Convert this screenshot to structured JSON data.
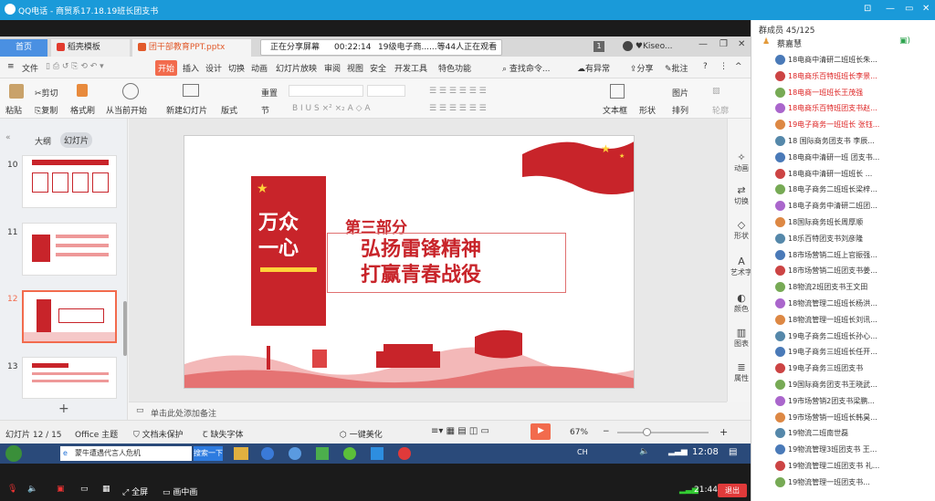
{
  "qq": {
    "title": "QQ电话 - 商贸系17.18.19班长团支书"
  },
  "tabs": {
    "home": "首页",
    "template": "稻壳模板",
    "doc": "团干部教育PPT.pptx",
    "user": "♥Kiseo..."
  },
  "share": {
    "status": "正在分享屏幕",
    "time": "00:22:14",
    "viewers": "19级电子商......等44人正在观看"
  },
  "menu": {
    "file": "文件",
    "items": [
      "开始",
      "插入",
      "设计",
      "切换",
      "动画",
      "幻灯片放映",
      "审阅",
      "视图",
      "安全",
      "开发工具",
      "特色功能"
    ],
    "search": "查找命令...",
    "problem": "有异常",
    "share": "分享",
    "comment": "批注"
  },
  "ribbon": {
    "paste": "粘贴",
    "cut": "剪切",
    "copy": "复制",
    "format": "格式刷",
    "from_current": "从当前开始",
    "new_slide": "新建幻灯片",
    "layout": "版式",
    "section": "节",
    "reset": "重置",
    "textbox": "文本框",
    "shape": "形状",
    "arrange": "排列",
    "picture": "图片",
    "outline": "轮廓"
  },
  "left": {
    "outline": "大纲",
    "slides": "幻灯片",
    "nums": [
      "10",
      "11",
      "12",
      "13"
    ],
    "add": "+"
  },
  "slide": {
    "left_title_1": "万众",
    "left_title_2": "一心",
    "part": "第三部分",
    "h1": "弘扬雷锋精神",
    "h2": "打赢青春战役"
  },
  "rightbar": [
    "动画",
    "切换",
    "形状",
    "艺术字",
    "颜色",
    "图表",
    "属性"
  ],
  "notes": {
    "placeholder": "单击此处添加备注"
  },
  "status": {
    "page": "幻灯片 12 / 15",
    "theme": "Office 主题",
    "protect": "文档未保护",
    "font": "缺失字体",
    "beautify": "一键美化",
    "zoom": "67%"
  },
  "taskbar": {
    "search": "蒙牛遭遇代言人危机",
    "search_btn": "搜索一下",
    "lang": "CH",
    "time": "12:08"
  },
  "bottom": {
    "fullscreen": "全屏",
    "pip": "画中画",
    "time": "21:44",
    "exit": "退出"
  },
  "panel": {
    "count": "群成员 45/125",
    "host": "蔡嘉慧",
    "members": [
      {
        "n": "18电商中清研二班班长朱...",
        "c": "#333"
      },
      {
        "n": "18电商乐百特班班长李景...",
        "c": "#d22"
      },
      {
        "n": "18电商一班班长王茂强",
        "c": "#d22"
      },
      {
        "n": "18电商乐百特班团支书赵...",
        "c": "#d22"
      },
      {
        "n": "19电子商务一班班长 张钰...",
        "c": "#d22"
      },
      {
        "n": "18  国际商务团支书 李辰...",
        "c": "#333"
      },
      {
        "n": "18电商中清研一班 团支书...",
        "c": "#333"
      },
      {
        "n": "18电商中清研一班班长 ...",
        "c": "#333"
      },
      {
        "n": "18电子商务二班班长梁梓...",
        "c": "#333"
      },
      {
        "n": "18电子商务中清研二班团...",
        "c": "#333"
      },
      {
        "n": "18国际商务班长周厚顺",
        "c": "#333"
      },
      {
        "n": "18乐百特团支书刘彦隆",
        "c": "#333"
      },
      {
        "n": "18市场营销二班上官振强...",
        "c": "#333"
      },
      {
        "n": "18市场营销二班团支书姜...",
        "c": "#333"
      },
      {
        "n": "18物流2班团支书王文田",
        "c": "#333"
      },
      {
        "n": "18物流管理二班班长杨洪...",
        "c": "#333"
      },
      {
        "n": "18物流管理一班班长刘讯...",
        "c": "#333"
      },
      {
        "n": "19电子商务二班班长孙心...",
        "c": "#333"
      },
      {
        "n": "19电子商务三班班长任开...",
        "c": "#333"
      },
      {
        "n": "19电子商务三班团支书",
        "c": "#333"
      },
      {
        "n": "19国际商务团支书王晓武...",
        "c": "#333"
      },
      {
        "n": "19市场营销2团支书梁鹏...",
        "c": "#333"
      },
      {
        "n": "19市场营销一班班长韩昊...",
        "c": "#333"
      },
      {
        "n": "19物流二班南世磊",
        "c": "#333"
      },
      {
        "n": "19物流管理3班团支书 王...",
        "c": "#333"
      },
      {
        "n": "19物流管理二班团支书 礼...",
        "c": "#333"
      },
      {
        "n": "19物流管理一班团支书...",
        "c": "#333"
      }
    ]
  },
  "colors": {
    "qq": "#1a9ad9",
    "accent": "#f26b4d",
    "red": "#c8242a"
  }
}
